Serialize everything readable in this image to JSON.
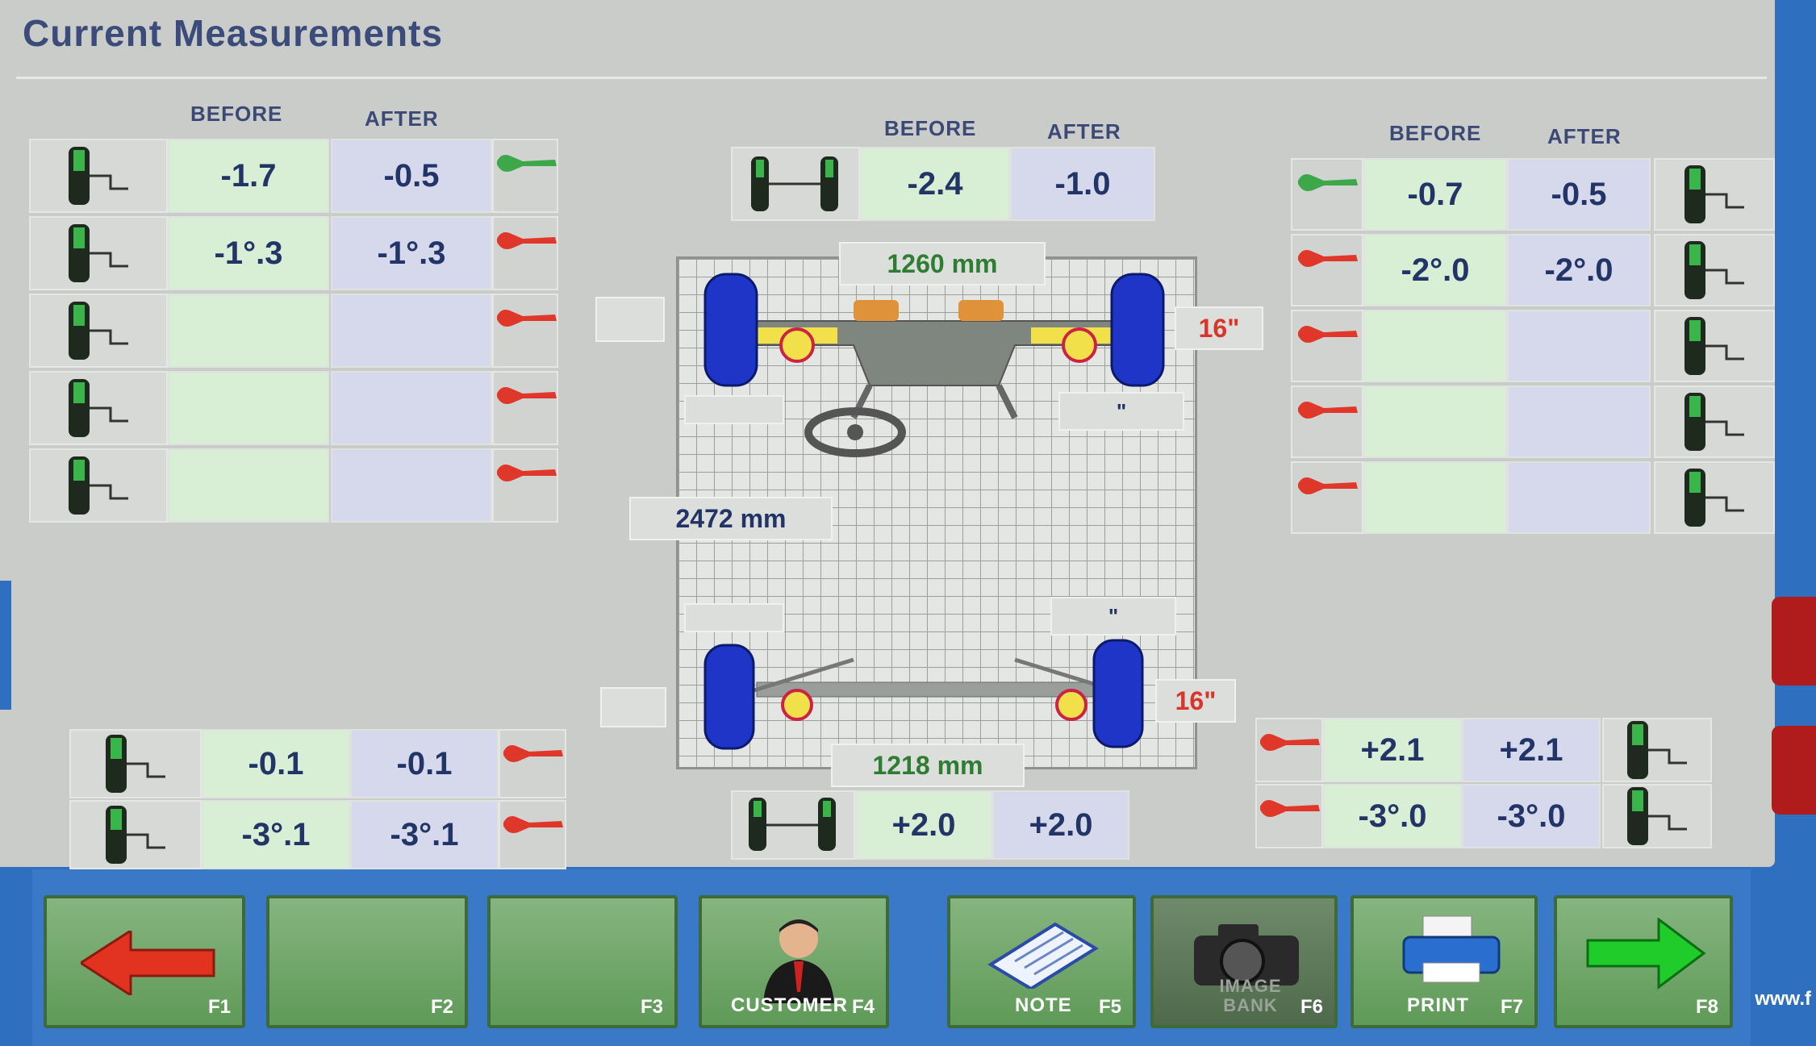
{
  "title": "Current Measurements",
  "headers": {
    "before": "BEFORE",
    "after": "AFTER"
  },
  "left_front": {
    "rows": [
      {
        "before": "-1.7",
        "after": "-0.5",
        "icon": "toe-icon",
        "status": "ok"
      },
      {
        "before": "-1°.3",
        "after": "-1°.3",
        "icon": "camber-icon",
        "status": "out"
      },
      {
        "before": "",
        "after": "",
        "icon": "caster-icon",
        "status": "out"
      },
      {
        "before": "",
        "after": "",
        "icon": "kingpin-icon",
        "status": "out"
      },
      {
        "before": "",
        "after": "",
        "icon": "included-angle-icon",
        "status": "out"
      }
    ]
  },
  "center_front": {
    "before": "-2.4",
    "after": "-1.0"
  },
  "right_front": {
    "rows": [
      {
        "before": "-0.7",
        "after": "-0.5",
        "status": "ok"
      },
      {
        "before": "-2°.0",
        "after": "-2°.0",
        "status": "out"
      },
      {
        "before": "",
        "after": "",
        "status": "out"
      },
      {
        "before": "",
        "after": "",
        "status": "out"
      },
      {
        "before": "",
        "after": "",
        "status": "out"
      }
    ]
  },
  "left_rear": {
    "rows": [
      {
        "before": "-0.1",
        "after": "-0.1"
      },
      {
        "before": "-3°.1",
        "after": "-3°.1"
      }
    ]
  },
  "center_rear": {
    "before": "+2.0",
    "after": "+2.0"
  },
  "right_rear": {
    "rows": [
      {
        "before": "+2.1",
        "after": "+2.1"
      },
      {
        "before": "-3°.0",
        "after": "-3°.0"
      }
    ]
  },
  "vehicle": {
    "front_track": "1260 mm",
    "rear_track": "1218 mm",
    "wheelbase": "2472 mm",
    "front_rim": "16\"",
    "rear_rim": "16\"",
    "front_right_note": "\"",
    "rear_right_note": "\""
  },
  "fkeys": [
    {
      "key": "F1",
      "label": "",
      "icon": "back-arrow-icon"
    },
    {
      "key": "F2",
      "label": ""
    },
    {
      "key": "F3",
      "label": ""
    },
    {
      "key": "F4",
      "label": "CUSTOMER",
      "icon": "customer-icon"
    },
    {
      "key": "F5",
      "label": "NOTE",
      "icon": "note-icon"
    },
    {
      "key": "F6",
      "label": "IMAGE BANK",
      "icon": "camera-icon"
    },
    {
      "key": "F7",
      "label": "PRINT",
      "icon": "printer-icon"
    },
    {
      "key": "F8",
      "label": "",
      "icon": "forward-arrow-icon"
    }
  ],
  "url": "www.f",
  "colors": {
    "ok": "#3da84a",
    "out": "#e0372b",
    "before_bg": "#d8efd5",
    "after_bg": "#d6d9ec",
    "wheel": "#1e35c8"
  }
}
